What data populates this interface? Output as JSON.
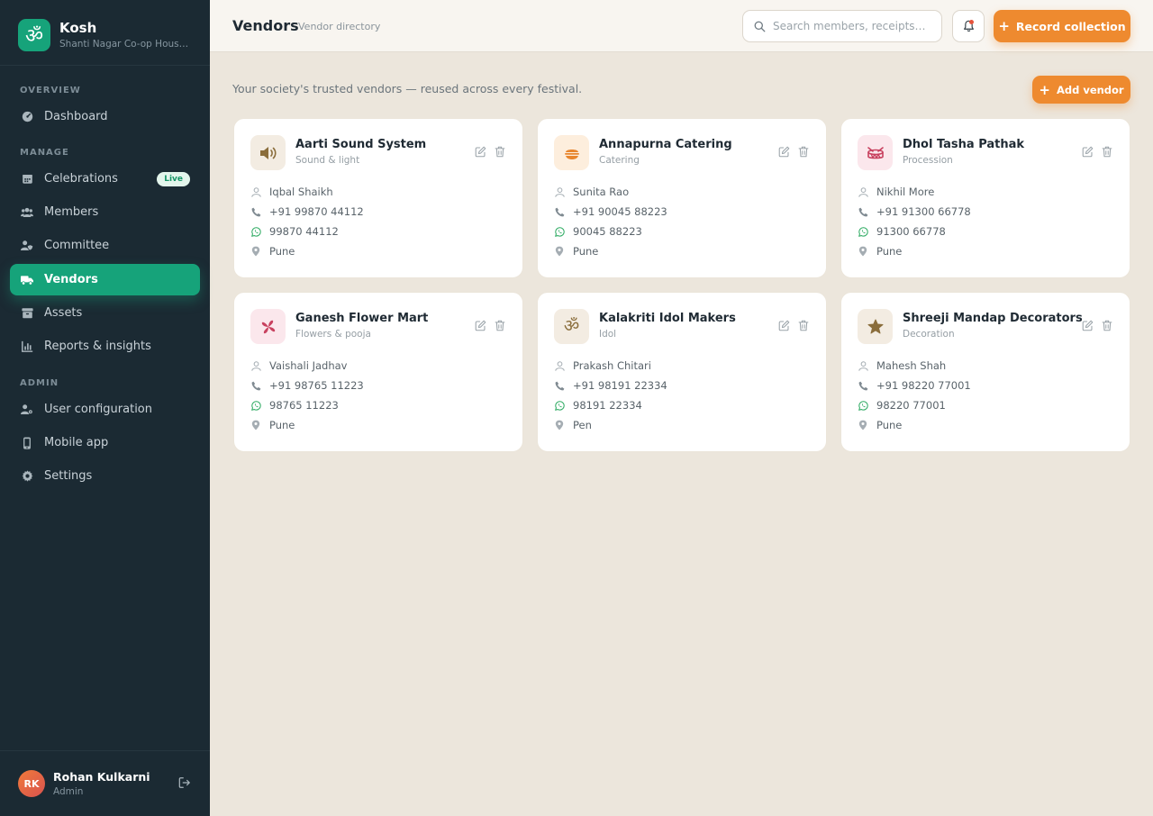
{
  "app": {
    "name": "Kosh",
    "society": "Shanti Nagar Co-op Housing Society",
    "logo_glyph": "ॐ",
    "accent": "#16a37a",
    "cta_color": "#ee8a2f"
  },
  "sidebar": {
    "sections": [
      {
        "label": "OVERVIEW"
      },
      {
        "label": "MANAGE"
      },
      {
        "label": "ADMIN"
      }
    ],
    "items": [
      {
        "label": "Dashboard",
        "icon": "gauge-icon"
      },
      {
        "label": "Celebrations",
        "icon": "calendar-icon",
        "badge": "Live"
      },
      {
        "label": "Members",
        "icon": "users-icon"
      },
      {
        "label": "Committee",
        "icon": "user-shield-icon"
      },
      {
        "label": "Vendors",
        "icon": "truck-icon",
        "active": true
      },
      {
        "label": "Assets",
        "icon": "archive-icon"
      },
      {
        "label": "Reports & insights",
        "icon": "bar-chart-icon"
      },
      {
        "label": "User configuration",
        "icon": "user-cog-icon"
      },
      {
        "label": "Mobile app",
        "icon": "mobile-icon"
      },
      {
        "label": "Settings",
        "icon": "gear-icon"
      }
    ]
  },
  "user": {
    "initials": "RK",
    "name": "Rohan Kulkarni",
    "role": "Admin"
  },
  "header": {
    "title": "Vendors",
    "subtitle": "Vendor directory",
    "search_placeholder": "Search members, receipts…",
    "record_label": "Record collection"
  },
  "main": {
    "intro": "Your society's trusted vendors — reused across every festival.",
    "add_label": "Add vendor",
    "vendors": [
      {
        "name": "Aarti Sound System",
        "category": "Sound & light",
        "contact": "Iqbal Shaikh",
        "phone": "+91 99870 44112",
        "whatsapp": "99870 44112",
        "city": "Pune",
        "icon": "speaker-icon",
        "icon_bg": "#f3ece2",
        "icon_color": "#8a6d3b"
      },
      {
        "name": "Annapurna Catering",
        "category": "Catering",
        "contact": "Sunita Rao",
        "phone": "+91 90045 88223",
        "whatsapp": "90045 88223",
        "city": "Pune",
        "icon": "bowl-icon",
        "icon_bg": "#fdeedd",
        "icon_color": "#e8862e"
      },
      {
        "name": "Dhol Tasha Pathak",
        "category": "Procession",
        "contact": "Nikhil More",
        "phone": "+91 91300 66778",
        "whatsapp": "91300 66778",
        "city": "Pune",
        "icon": "drum-icon",
        "icon_bg": "#fbe7ec",
        "icon_color": "#c8415f"
      },
      {
        "name": "Ganesh Flower Mart",
        "category": "Flowers & pooja",
        "contact": "Vaishali Jadhav",
        "phone": "+91 98765 11223",
        "whatsapp": "98765 11223",
        "city": "Pune",
        "icon": "flower-icon",
        "icon_bg": "#fbe7ec",
        "icon_color": "#c8415f"
      },
      {
        "name": "Kalakriti Idol Makers",
        "category": "Idol",
        "contact": "Prakash Chitari",
        "phone": "+91 98191 22334",
        "whatsapp": "98191 22334",
        "city": "Pen",
        "icon": "om-icon",
        "icon_bg": "#f3ece2",
        "icon_color": "#8a6d3b"
      },
      {
        "name": "Shreeji Mandap Decorators",
        "category": "Decoration",
        "contact": "Mahesh Shah",
        "phone": "+91 98220 77001",
        "whatsapp": "98220 77001",
        "city": "Pune",
        "icon": "star-icon",
        "icon_bg": "#f3ece2",
        "icon_color": "#8a6d3b"
      }
    ]
  }
}
